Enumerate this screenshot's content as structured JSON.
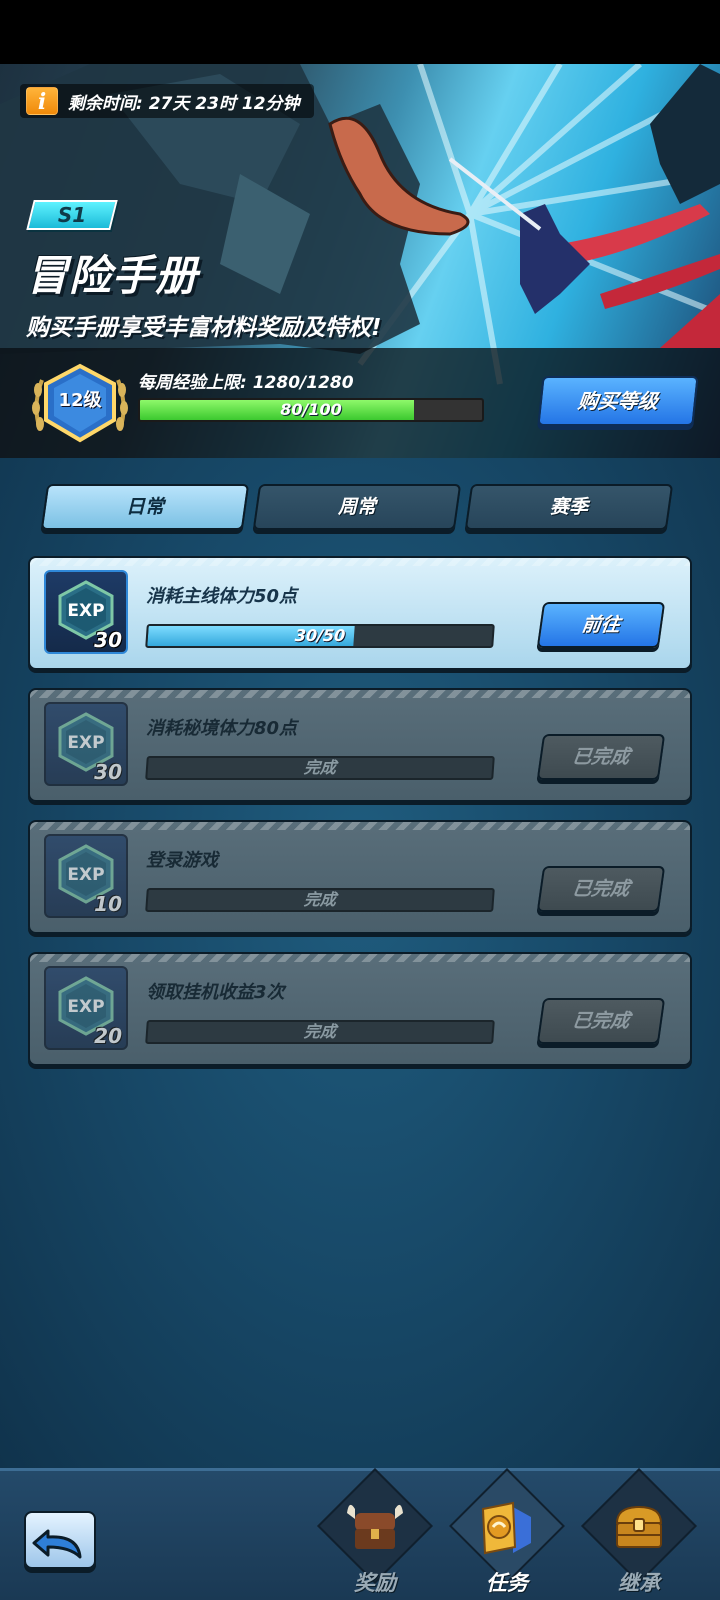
{
  "banner": {
    "remaining_time": "剩余时间: 27天 23时 12分钟",
    "season": "S1",
    "title": "冒险手册",
    "subtitle": "购买手册享受丰富材料奖励及特权!",
    "level": "12级",
    "weekly_exp_label": "每周经验上限: 1280/1280",
    "exp_progress_text": "80/100",
    "exp_progress": 0.8,
    "buy_level_label": "购买等级"
  },
  "tabs": [
    {
      "label": "日常",
      "active": true
    },
    {
      "label": "周常",
      "active": false
    },
    {
      "label": "赛季",
      "active": false
    }
  ],
  "tasks": [
    {
      "exp_icon": "EXP",
      "exp": "30",
      "name": "消耗主线体力50点",
      "progress_text": "30/50",
      "progress": 0.6,
      "button": "前往",
      "state": "active"
    },
    {
      "exp_icon": "EXP",
      "exp": "30",
      "name": "消耗秘境体力80点",
      "progress_text": "完成",
      "progress": 1,
      "button": "已完成",
      "state": "done"
    },
    {
      "exp_icon": "EXP",
      "exp": "10",
      "name": "登录游戏",
      "progress_text": "完成",
      "progress": 1,
      "button": "已完成",
      "state": "done"
    },
    {
      "exp_icon": "EXP",
      "exp": "20",
      "name": "领取挂机收益3次",
      "progress_text": "完成",
      "progress": 1,
      "button": "已完成",
      "state": "done"
    }
  ],
  "nav": {
    "back_icon": "back-arrow-icon",
    "items": [
      {
        "label": "奖励",
        "icon": "chest-viking-icon",
        "active": false
      },
      {
        "label": "任务",
        "icon": "task-badge-icon",
        "active": true
      },
      {
        "label": "继承",
        "icon": "treasure-chest-icon",
        "active": false
      }
    ]
  },
  "colors": {
    "accent_blue": "#2475e6",
    "progress_green": "#3cc92f",
    "progress_cyan": "#34a8dc",
    "season_badge": "#1bbbd8"
  }
}
